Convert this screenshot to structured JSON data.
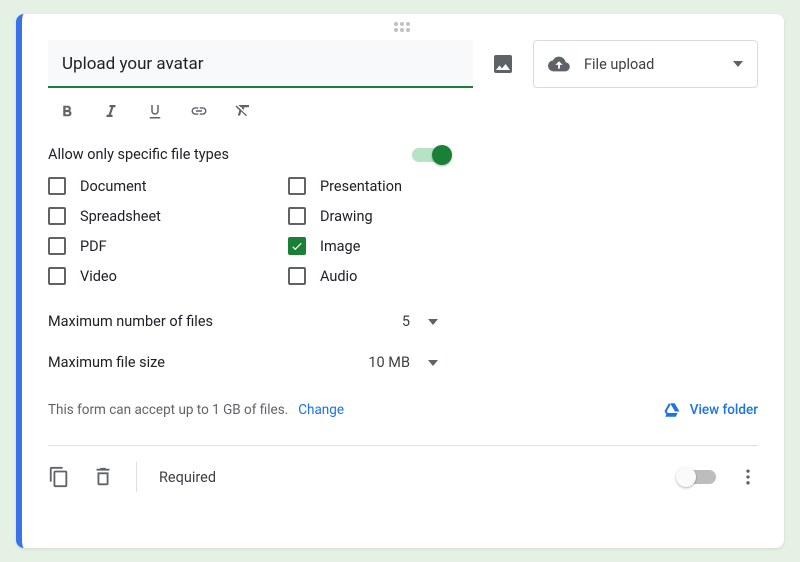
{
  "question": {
    "title": "Upload your avatar"
  },
  "typeSelect": {
    "label": "File upload"
  },
  "allowSpecific": {
    "label": "Allow only specific file types",
    "on": true
  },
  "fileTypes": {
    "col1": [
      {
        "label": "Document",
        "checked": false
      },
      {
        "label": "Spreadsheet",
        "checked": false
      },
      {
        "label": "PDF",
        "checked": false
      },
      {
        "label": "Video",
        "checked": false
      }
    ],
    "col2": [
      {
        "label": "Presentation",
        "checked": false
      },
      {
        "label": "Drawing",
        "checked": false
      },
      {
        "label": "Image",
        "checked": true
      },
      {
        "label": "Audio",
        "checked": false
      }
    ]
  },
  "maxFiles": {
    "label": "Maximum number of files",
    "value": "5"
  },
  "maxSize": {
    "label": "Maximum file size",
    "value": "10 MB"
  },
  "note": {
    "text": "This form can accept up to 1 GB of files.",
    "change": "Change",
    "viewFolder": "View folder"
  },
  "footer": {
    "required": "Required",
    "requiredOn": false
  }
}
